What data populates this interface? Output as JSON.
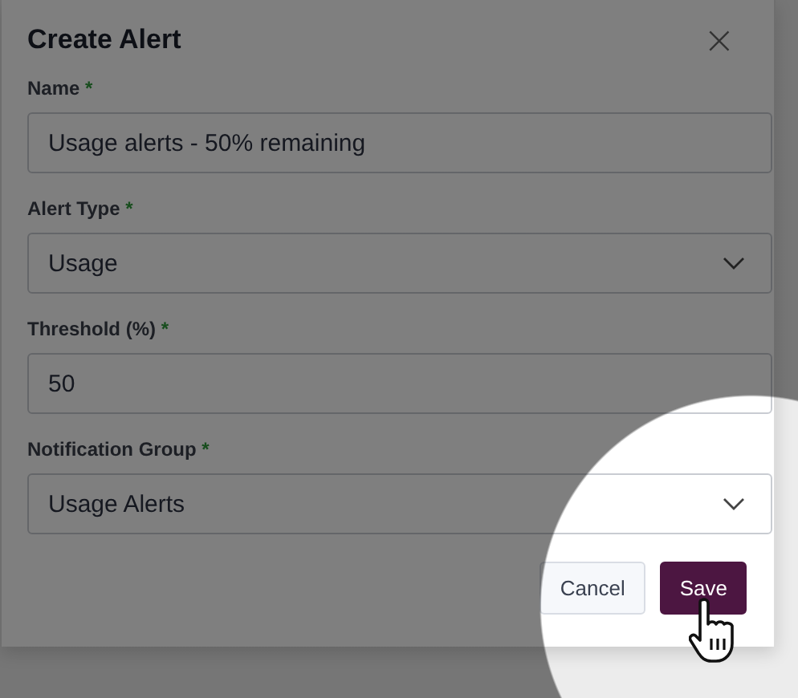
{
  "dialog": {
    "title": "Create Alert",
    "close": "×"
  },
  "fields": [
    {
      "kind": "text",
      "label": "Name",
      "required_mark": "*",
      "value": "Usage alerts - 50% remaining"
    },
    {
      "kind": "select",
      "label": "Alert Type",
      "required_mark": "*",
      "value": "Usage"
    },
    {
      "kind": "text",
      "label": "Threshold (%)",
      "required_mark": "*",
      "value": "50"
    },
    {
      "kind": "select",
      "label": "Notification Group",
      "required_mark": "*",
      "value": "Usage Alerts"
    }
  ],
  "buttons": [
    {
      "kind": "secondary",
      "label": "Cancel"
    },
    {
      "kind": "primary",
      "label": "Save"
    }
  ]
}
